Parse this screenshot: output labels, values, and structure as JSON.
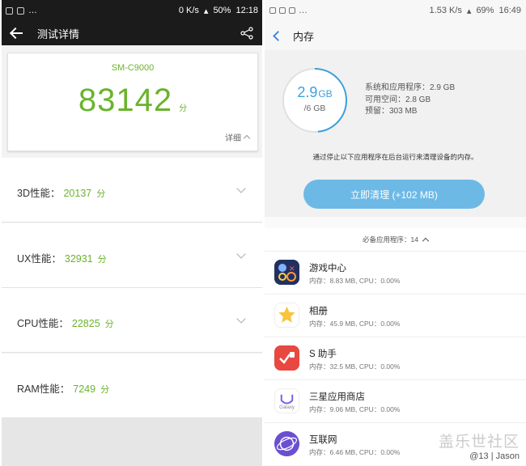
{
  "left": {
    "status": {
      "speed": "0 K/s",
      "battery": "50%",
      "time": "12:18"
    },
    "toolbar": {
      "title": "测试详情"
    },
    "score_card": {
      "model": "SM-C9000",
      "score": "83142",
      "unit": "分",
      "detail_label": "详细"
    },
    "perf": [
      {
        "label": "3D性能：",
        "value": "20137",
        "unit": "分"
      },
      {
        "label": "UX性能：",
        "value": "32931",
        "unit": "分"
      },
      {
        "label": "CPU性能：",
        "value": "22825",
        "unit": "分"
      },
      {
        "label": "RAM性能：",
        "value": "7249",
        "unit": "分"
      }
    ]
  },
  "right": {
    "status": {
      "speed": "1.53 K/s",
      "battery": "69%",
      "time": "16:49"
    },
    "toolbar": {
      "title": "内存"
    },
    "memory": {
      "used": "2.9",
      "used_unit": "GB",
      "total": "/6 GB",
      "used_fraction": 0.483,
      "stats": [
        "系统和应用程序：2.9 GB",
        "可用空间：2.8 GB",
        "预留：303 MB"
      ],
      "note": "通过停止以下应用程序在后台运行来清理设备的内存。",
      "clean_button": "立即清理 (+102 MB)"
    },
    "section_header": "必备应用程序：14",
    "apps": [
      {
        "name": "游戏中心",
        "mem": "内存：8.83 MB, CPU：0.00%"
      },
      {
        "name": "相册",
        "mem": "内存：45.9 MB, CPU：0.00%"
      },
      {
        "name": "S 助手",
        "mem": "内存：32.5 MB, CPU：0.00%"
      },
      {
        "name": "三星应用商店",
        "mem": "内存：9.06 MB, CPU：0.00%",
        "icon_text": "Galaxy"
      },
      {
        "name": "互联网",
        "mem": "内存：6.46 MB, CPU：0.00%"
      }
    ]
  },
  "watermark": {
    "line1": "盖乐世社区",
    "line2": "@13 | Jason"
  },
  "colors": {
    "score_green": "#6ab42b",
    "accent_blue": "#3d9fdd",
    "button_blue": "#6db9e6",
    "dark_bar": "#1b1b1b"
  }
}
